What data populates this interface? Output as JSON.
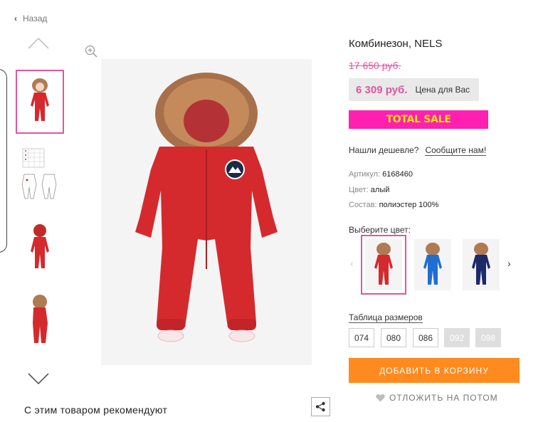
{
  "nav": {
    "back_label": "Назад"
  },
  "product": {
    "title": "Комбинезон, NELS",
    "old_price": "17 650 руб.",
    "new_price": "6 309 руб.",
    "price_note": "Цена для Вас",
    "sale_banner": "TOTAL SALE",
    "cheaper_question": "Нашли дешевле?",
    "cheaper_link": "Сообщите нам!",
    "article_label": "Артикул:",
    "article_value": "6168460",
    "color_label": "Цвет:",
    "color_value": "алый",
    "composition_label": "Состав:",
    "composition_value": "полиэстер 100%"
  },
  "colors": {
    "title": "Выберите цвет:",
    "swatches": [
      "red",
      "blue",
      "navy"
    ]
  },
  "sizes": {
    "table_link": "Таблица размеров",
    "items": [
      {
        "label": "074",
        "available": true
      },
      {
        "label": "080",
        "available": true
      },
      {
        "label": "086",
        "available": true
      },
      {
        "label": "092",
        "available": false
      },
      {
        "label": "098",
        "available": false
      }
    ]
  },
  "actions": {
    "add_to_cart": "ДОБАВИТЬ В КОРЗИНУ",
    "save_later": "ОТЛОЖИТЬ НА ПОТОМ"
  },
  "recommend": {
    "title": "С этим товаром рекомендуют"
  },
  "theme": {
    "accent": "#e0569e",
    "sale_bg": "#ff1fb0",
    "sale_text": "#ffe600",
    "cta": "#ff8a1f",
    "product_red": "#d42a2e"
  },
  "icons": [
    "chevron-left-icon",
    "chevron-up-icon",
    "chevron-down-icon",
    "zoom-in-icon",
    "share-icon",
    "heart-icon",
    "arrow-left-icon",
    "arrow-right-icon"
  ]
}
